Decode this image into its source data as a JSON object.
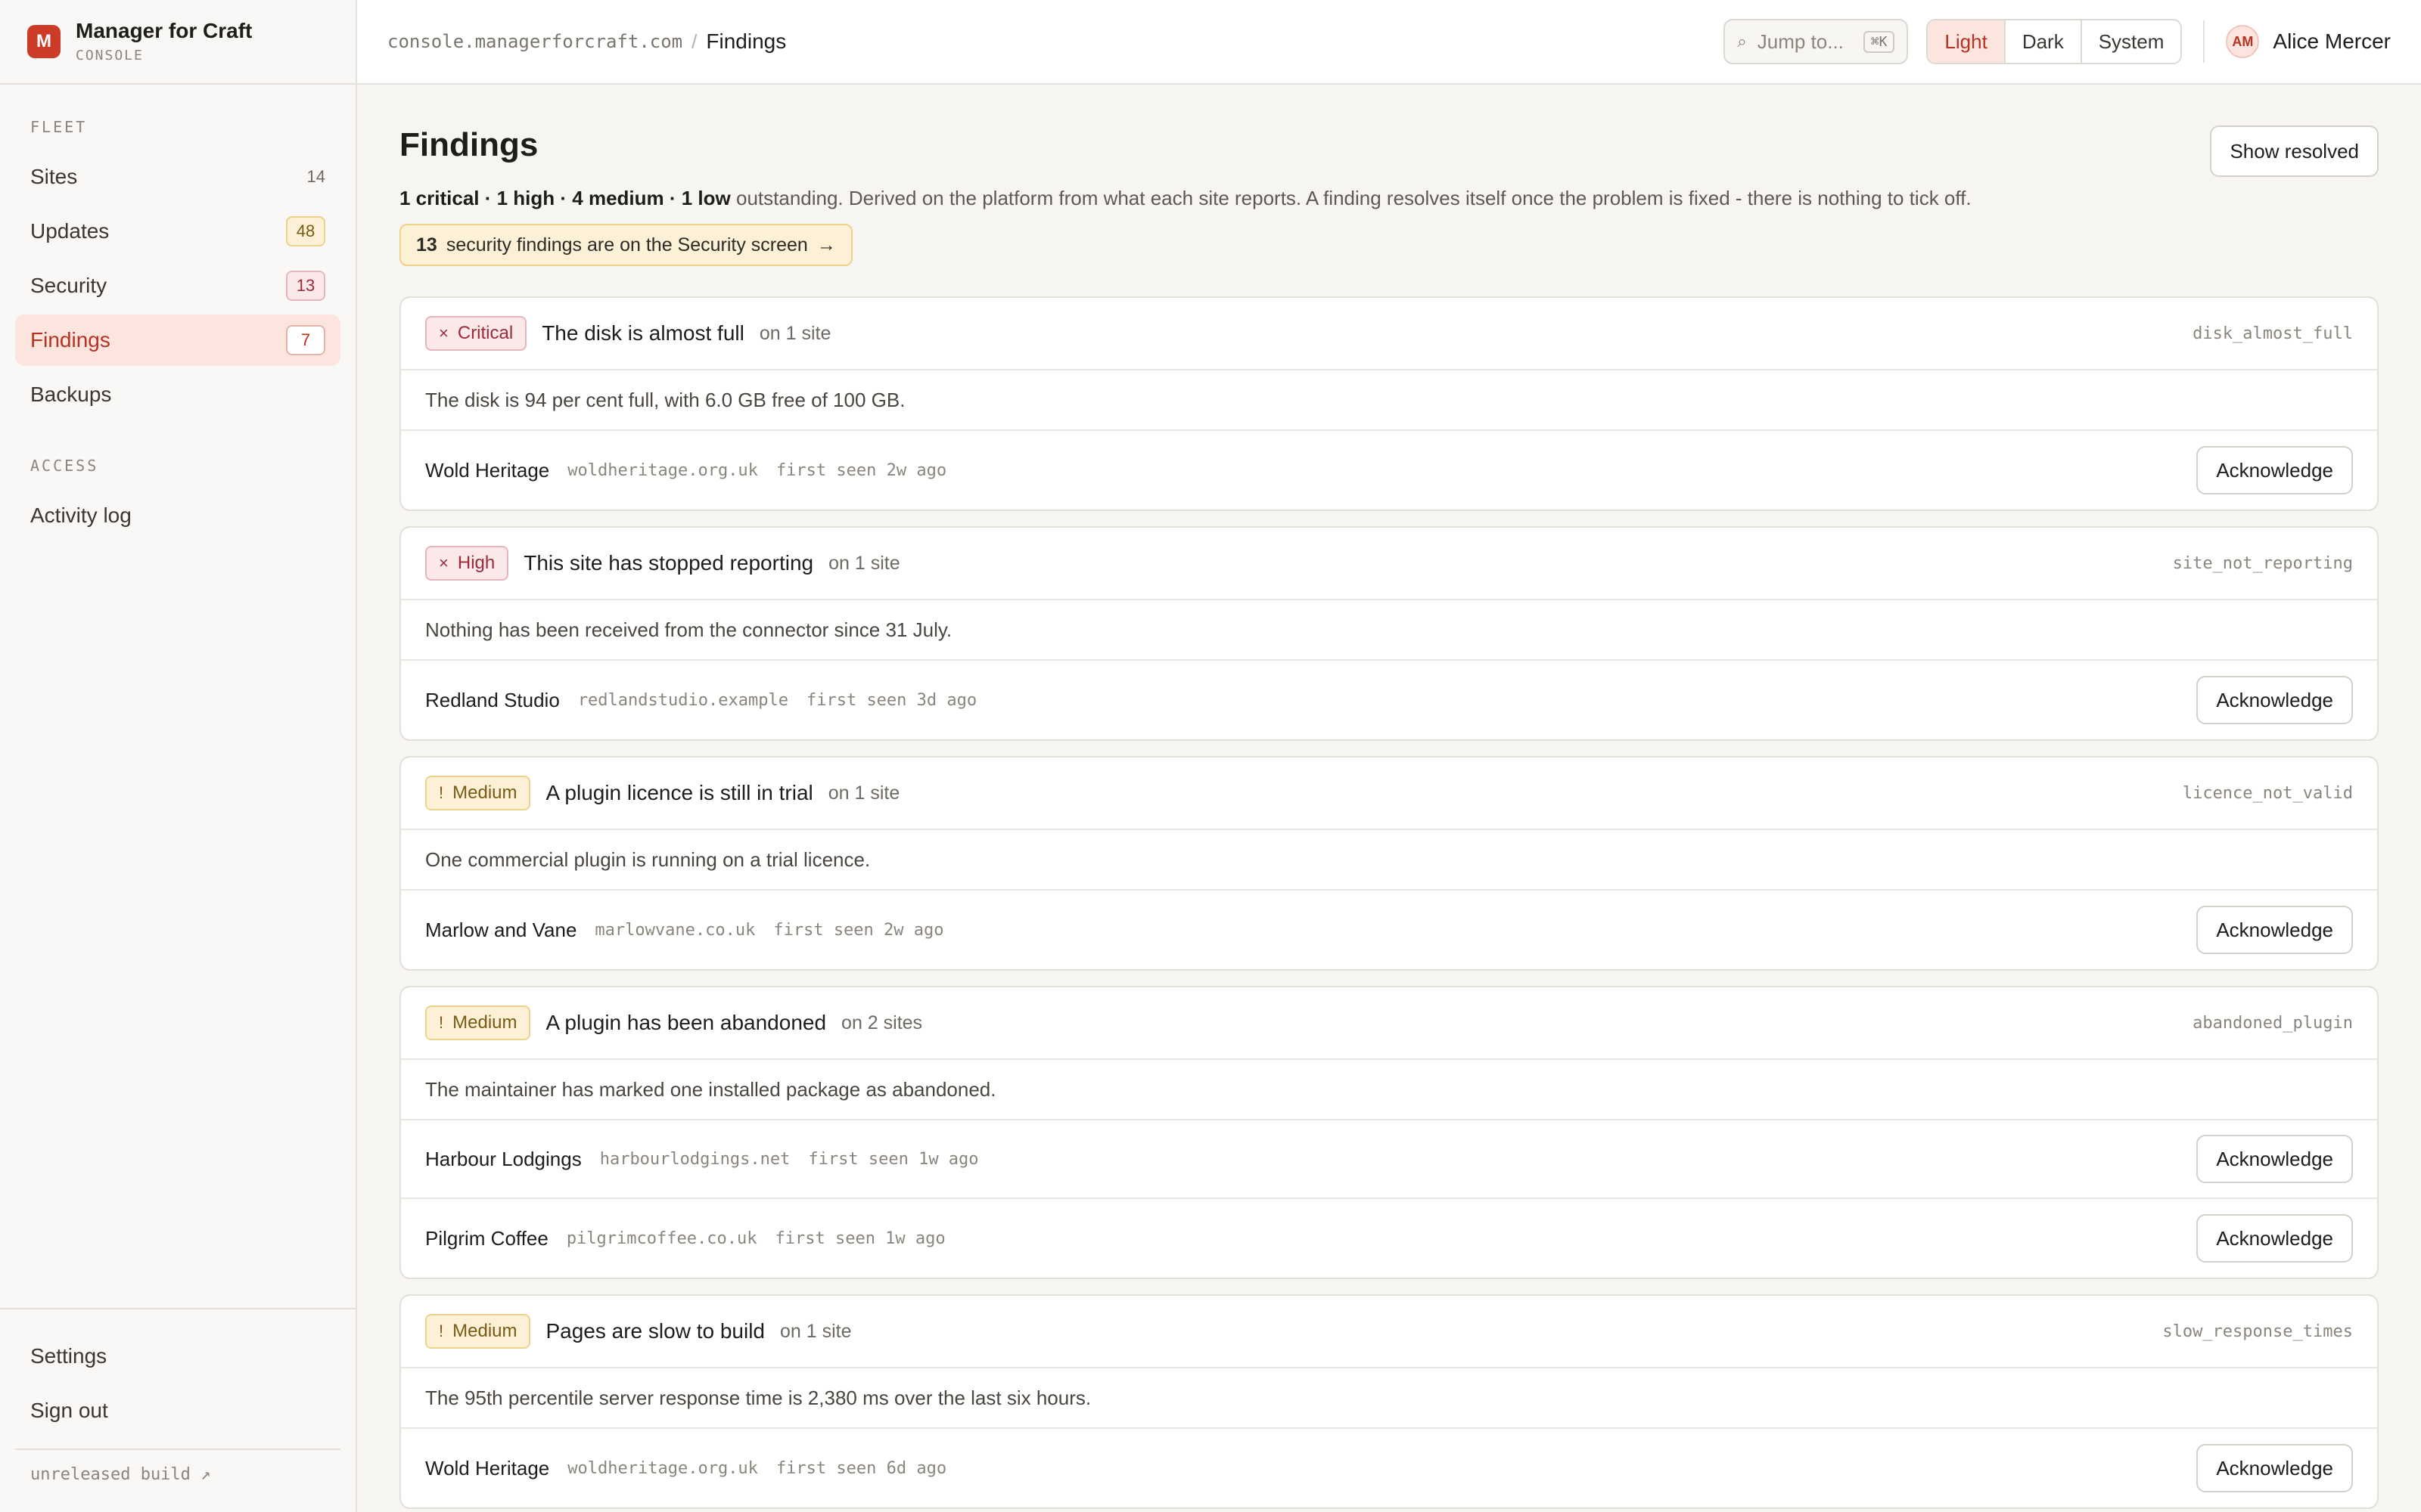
{
  "brand": {
    "logo_letter": "M",
    "name": "Manager for Craft",
    "sub": "CONSOLE"
  },
  "sidebar": {
    "sections": [
      {
        "label": "FLEET",
        "items": [
          {
            "label": "Sites",
            "count": "14"
          },
          {
            "label": "Updates",
            "count": "48"
          },
          {
            "label": "Security",
            "count": "13"
          },
          {
            "label": "Findings",
            "count": "7"
          },
          {
            "label": "Backups",
            "count": ""
          }
        ]
      },
      {
        "label": "ACCESS",
        "items": [
          {
            "label": "Activity log",
            "count": ""
          }
        ]
      }
    ],
    "bottom": {
      "settings": "Settings",
      "sign_out": "Sign out",
      "build": "unreleased build ↗"
    }
  },
  "topbar": {
    "host": "console.managerforcraft.com",
    "separator": "/",
    "page": "Findings",
    "jump_placeholder": "Jump to...",
    "jump_icon": "⌕",
    "jump_shortcut": "⌘K",
    "themes": [
      "Light",
      "Dark",
      "System"
    ],
    "active_theme": "Light",
    "user": {
      "initials": "AM",
      "name": "Alice Mercer"
    }
  },
  "page": {
    "title": "Findings",
    "show_resolved": "Show resolved",
    "summary": {
      "counts": "1 critical · 1 high · 4 medium · 1 low",
      "rest": " outstanding. Derived on the platform from what each site reports. A finding resolves itself once the problem is fixed - there is nothing to tick off."
    },
    "security_note": {
      "count": "13",
      "text": "security findings are on the Security screen",
      "arrow": "→"
    }
  },
  "findings": [
    {
      "severity": "Critical",
      "mark": "×",
      "title": "The disk is almost full",
      "sites": "on 1 site",
      "code": "disk_almost_full",
      "description": "The disk is 94 per cent full, with 6.0 GB free of 100 GB.",
      "rows": [
        {
          "name": "Wold Heritage",
          "host": "woldheritage.org.uk",
          "seen": "first seen 2w ago",
          "action": "Acknowledge"
        }
      ]
    },
    {
      "severity": "High",
      "mark": "×",
      "title": "This site has stopped reporting",
      "sites": "on 1 site",
      "code": "site_not_reporting",
      "description": "Nothing has been received from the connector since 31 July.",
      "rows": [
        {
          "name": "Redland Studio",
          "host": "redlandstudio.example",
          "seen": "first seen 3d ago",
          "action": "Acknowledge"
        }
      ]
    },
    {
      "severity": "Medium",
      "mark": "!",
      "title": "A plugin licence is still in trial",
      "sites": "on 1 site",
      "code": "licence_not_valid",
      "description": "One commercial plugin is running on a trial licence.",
      "rows": [
        {
          "name": "Marlow and Vane",
          "host": "marlowvane.co.uk",
          "seen": "first seen 2w ago",
          "action": "Acknowledge"
        }
      ]
    },
    {
      "severity": "Medium",
      "mark": "!",
      "title": "A plugin has been abandoned",
      "sites": "on 2 sites",
      "code": "abandoned_plugin",
      "description": "The maintainer has marked one installed package as abandoned.",
      "rows": [
        {
          "name": "Harbour Lodgings",
          "host": "harbourlodgings.net",
          "seen": "first seen 1w ago",
          "action": "Acknowledge"
        },
        {
          "name": "Pilgrim Coffee",
          "host": "pilgrimcoffee.co.uk",
          "seen": "first seen 1w ago",
          "action": "Acknowledge"
        }
      ]
    },
    {
      "severity": "Medium",
      "mark": "!",
      "title": "Pages are slow to build",
      "sites": "on 1 site",
      "code": "slow_response_times",
      "description": "The 95th percentile server response time is 2,380 ms over the last six hours.",
      "rows": [
        {
          "name": "Wold Heritage",
          "host": "woldheritage.org.uk",
          "seen": "first seen 6d ago",
          "action": "Acknowledge"
        }
      ]
    }
  ]
}
